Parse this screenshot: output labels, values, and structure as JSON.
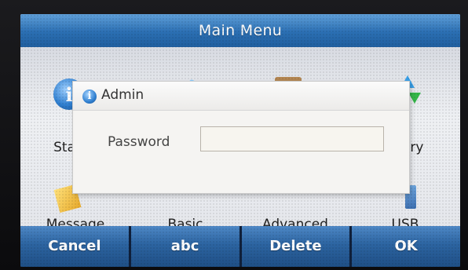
{
  "window": {
    "title": "Main Menu"
  },
  "menu": {
    "items": [
      {
        "label": "Sta",
        "icon": "status-info-icon"
      },
      {
        "label": "",
        "icon": "features-icon"
      },
      {
        "label": "",
        "icon": "directory-book-icon"
      },
      {
        "label": "ory",
        "icon": "history-arrows-icon"
      },
      {
        "label": "Message",
        "icon": "message-icon"
      },
      {
        "label": "Basic",
        "icon": "basic-settings-icon"
      },
      {
        "label": "Advanced",
        "icon": "advanced-settings-icon"
      },
      {
        "label": "USB",
        "icon": "usb-icon"
      }
    ]
  },
  "dialog": {
    "title": "Admin",
    "icon": "info-icon",
    "password_label": "Password",
    "password_value": ""
  },
  "softkeys": {
    "cancel": "Cancel",
    "abc": "abc",
    "delete": "Delete",
    "ok": "OK"
  },
  "colors": {
    "titlebar": "#2b6fb3",
    "softkey": "#2c64a1"
  }
}
